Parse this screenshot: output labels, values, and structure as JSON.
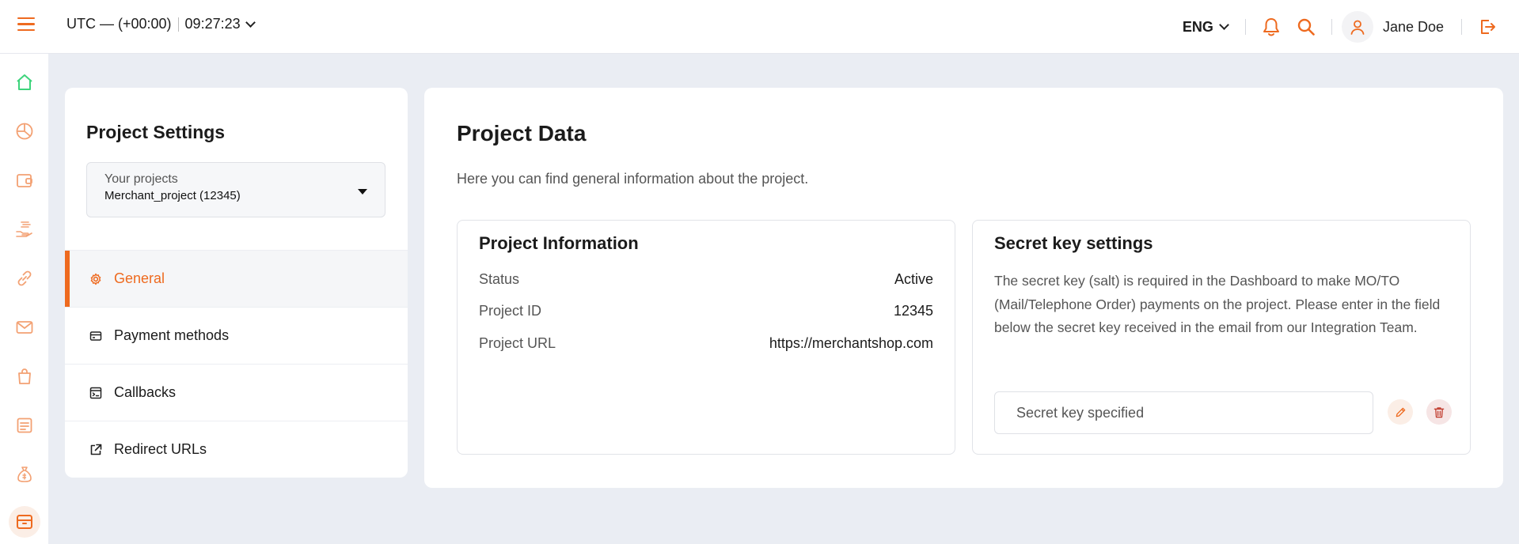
{
  "header": {
    "timezone": "UTC — (+00:00)",
    "time": "09:27:23",
    "language": "ENG",
    "user_name": "Jane Doe",
    "accent_color": "#ee6a1f"
  },
  "rail": {
    "icons": [
      "home-icon",
      "pie-chart-icon",
      "wallet-icon",
      "payout-hand-icon",
      "link-icon",
      "mail-icon",
      "shopping-bag-icon",
      "report-icon",
      "money-bag-icon",
      "archive-box-icon"
    ]
  },
  "left_panel": {
    "title": "Project Settings",
    "project_select": {
      "label": "Your projects",
      "value": "Merchant_project (12345)"
    },
    "menu": [
      {
        "label": "General",
        "icon": "gear-icon",
        "active": true
      },
      {
        "label": "Payment methods",
        "icon": "card-icon"
      },
      {
        "label": "Callbacks",
        "icon": "terminal-icon"
      },
      {
        "label": "Redirect URLs",
        "icon": "external-link-icon"
      }
    ]
  },
  "main": {
    "title": "Project Data",
    "subtitle": "Here you can find general information about the project.",
    "info_card": {
      "title": "Project Information",
      "rows": [
        {
          "key": "Status",
          "value": "Active"
        },
        {
          "key": "Project ID",
          "value": "12345"
        },
        {
          "key": "Project URL",
          "value": "https://merchantshop.com"
        }
      ]
    },
    "secret_card": {
      "title": "Secret key settings",
      "description": "The secret key (salt) is required in the Dashboard to make MO/TO (Mail/Telephone Order) payments on the project. Please enter in the field below the secret key received in the email from our Integration Team.",
      "input_placeholder": "Secret key specified"
    }
  }
}
